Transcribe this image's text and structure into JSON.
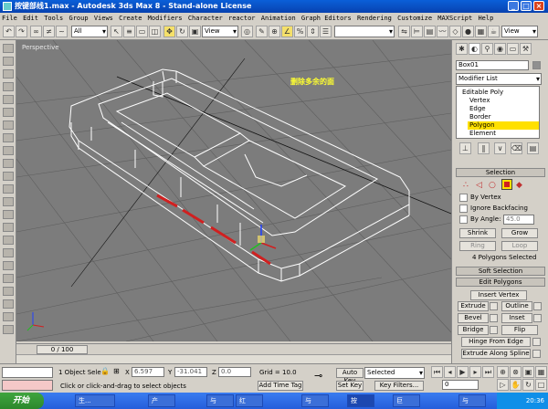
{
  "window": {
    "title": "按键部线1.max - Autodesk 3ds Max 8 - Stand-alone License"
  },
  "menu": [
    "File",
    "Edit",
    "Tools",
    "Group",
    "Views",
    "Create",
    "Modifiers",
    "Character",
    "reactor",
    "Animation",
    "Graph Editors",
    "Rendering",
    "Customize",
    "MAXScript",
    "Help"
  ],
  "toolbar": {
    "selection_filter": "All",
    "ref_coord": "View",
    "ref_coord2": "View"
  },
  "viewport": {
    "label": "Perspective",
    "annotation": "删除多余的面"
  },
  "panel": {
    "object_name": "Box01",
    "modifier_list": "Modifier List",
    "stack": [
      "Editable Poly",
      "Vertex",
      "Edge",
      "Border",
      "Polygon",
      "Element"
    ],
    "selection": {
      "header": "Selection",
      "by_vertex": "By Vertex",
      "ignore_backfacing": "Ignore Backfacing",
      "by_angle": "By Angle:",
      "angle_value": "45.0",
      "shrink": "Shrink",
      "grow": "Grow",
      "ring": "Ring",
      "loop": "Loop",
      "status": "4 Polygons Selected"
    },
    "soft_selection": "Soft Selection",
    "edit_polygons": {
      "header": "Edit Polygons",
      "insert_vertex": "Insert Vertex",
      "extrude": "Extrude",
      "outline": "Outline",
      "bevel": "Bevel",
      "inset": "Inset",
      "bridge": "Bridge",
      "flip": "Flip",
      "hinge": "Hinge From Edge",
      "extrude_spline": "Extrude Along Spline"
    }
  },
  "timeslider": {
    "frame": "0 / 100"
  },
  "status": {
    "selected": "1 Object Sele",
    "x_label": "X",
    "x": "6.597",
    "y_label": "Y",
    "y": "-31.041",
    "z_label": "Z",
    "z": "0.0",
    "grid": "Grid = 10.0",
    "prompt": "Click or click-and-drag to select objects",
    "add_time_tag": "Add Time Tag",
    "auto_key": "Auto Key",
    "selected_dd": "Selected",
    "set_key": "Set Key",
    "key_filters": "Key Filters...",
    "frame_field": "0"
  },
  "taskbar": {
    "start": "开始",
    "tasks": [
      "生...",
      "产",
      "与",
      "红",
      "与",
      "按",
      "巨",
      "与"
    ],
    "clock": "20:36"
  },
  "colors": {
    "title": "#0a5fd8",
    "viewport": "#7c7c7c",
    "selection_red": "#d02020",
    "polygon_highlight": "#ffe000"
  }
}
